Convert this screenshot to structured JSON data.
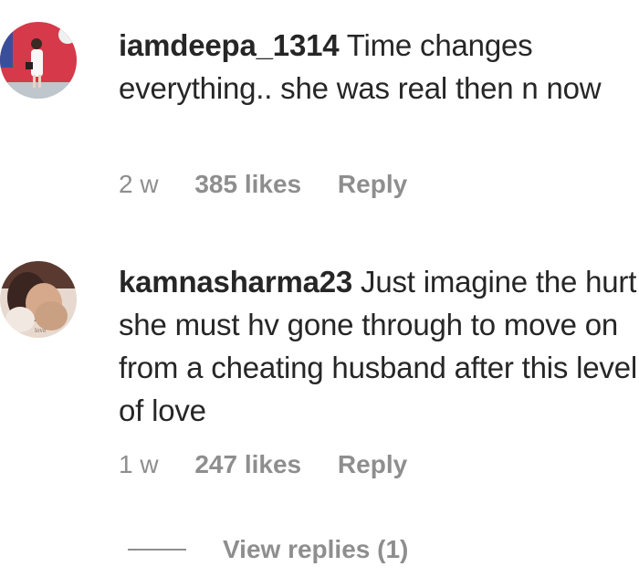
{
  "comments": [
    {
      "username": "iamdeepa_1314",
      "text": "Time changes everything.. she was real then n now",
      "time": "2 w",
      "likes": "385 likes",
      "reply_label": "Reply",
      "avatar_icon": "profile-photo-woman-white-dress"
    },
    {
      "username": "kamnasharma23",
      "text": "Just imagine the hurt she must hv gone through to move on from a cheating husband after this level of love",
      "time": "1 w",
      "likes": "247 likes",
      "reply_label": "Reply",
      "avatar_icon": "profile-photo-portrait"
    }
  ],
  "view_replies_label": "View replies (1)"
}
